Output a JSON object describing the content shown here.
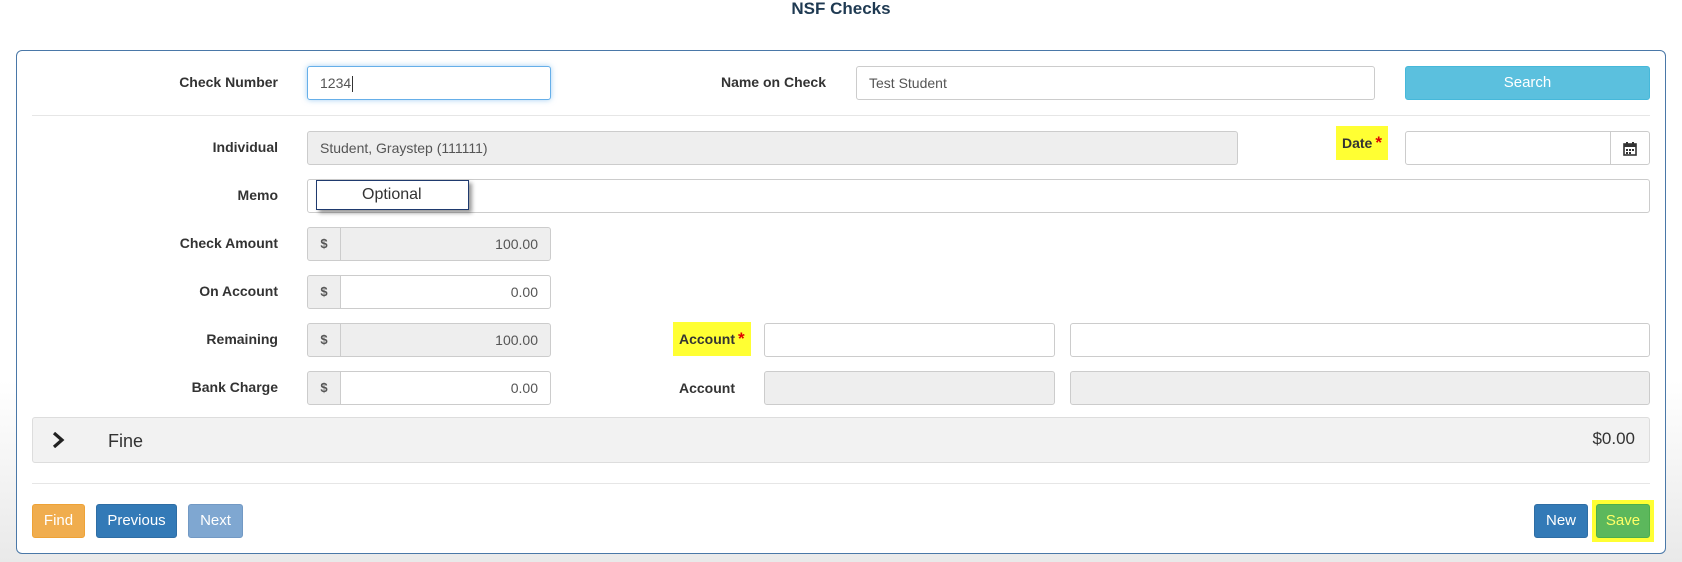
{
  "page_title": "NSF Checks",
  "search_row": {
    "check_number_label": "Check Number",
    "check_number_value": "1234",
    "name_on_check_label": "Name on Check",
    "name_on_check_value": "Test Student",
    "search_button": "Search"
  },
  "form": {
    "individual_label": "Individual",
    "individual_value": "Student, Graystep (111111)",
    "date_label": "Date",
    "date_required": "*",
    "date_value": "",
    "memo_label": "Memo",
    "memo_value": "",
    "memo_tooltip": "Optional",
    "check_amount_label": "Check Amount",
    "check_amount_value": "100.00",
    "on_account_label": "On Account",
    "on_account_value": "0.00",
    "remaining_label": "Remaining",
    "remaining_value": "100.00",
    "bank_charge_label": "Bank Charge",
    "bank_charge_value": "0.00",
    "currency_symbol": "$",
    "account_required_label": "Account",
    "account_required_marker": "*",
    "account_label": "Account",
    "account1_code": "",
    "account1_desc": "",
    "account2_code": "",
    "account2_desc": ""
  },
  "fine": {
    "label": "Fine",
    "amount": "$0.00"
  },
  "footer": {
    "find": "Find",
    "previous": "Previous",
    "next": "Next",
    "new": "New",
    "save": "Save"
  },
  "colors": {
    "primary": "#337ab7",
    "info": "#5bc0de",
    "warning": "#f0ad4e",
    "success": "#5cb85c",
    "highlight": "#ffff33",
    "required": "#e00000"
  }
}
